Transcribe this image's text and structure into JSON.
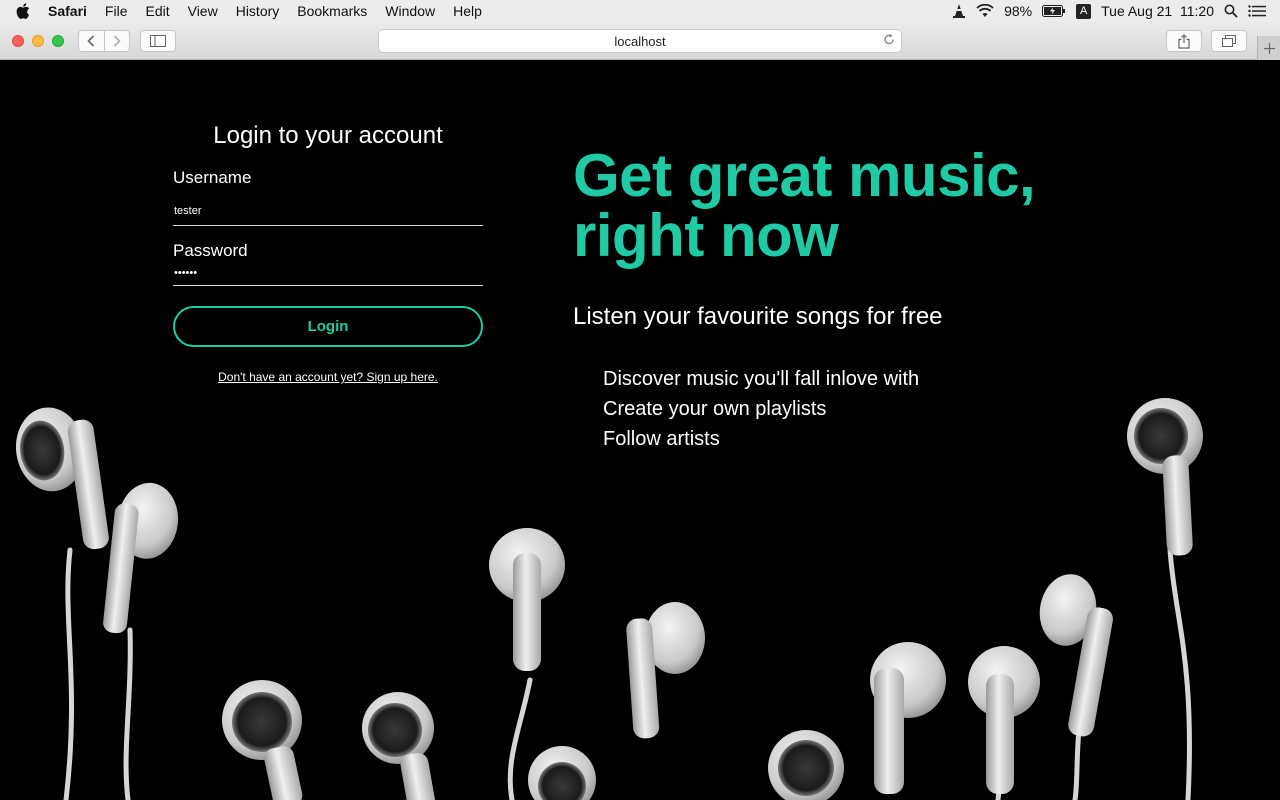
{
  "menubar": {
    "app_name": "Safari",
    "menus": [
      "File",
      "Edit",
      "View",
      "History",
      "Bookmarks",
      "Window",
      "Help"
    ],
    "battery": "98%",
    "input_source": "A",
    "datetime": "Tue Aug 21  11:20"
  },
  "browser": {
    "address": "localhost"
  },
  "login": {
    "title": "Login to your account",
    "username_label": "Username",
    "username_value": "tester",
    "password_label": "Password",
    "password_value": "tester",
    "button_label": "Login",
    "signup_link": "Don't have an account yet? Sign up here."
  },
  "hero": {
    "headline_line1": "Get great music,",
    "headline_line2": "right now",
    "subheading": "Listen your favourite songs for free",
    "features": [
      "Discover music you'll fall inlove with",
      "Create your own playlists",
      "Follow artists"
    ]
  },
  "colors": {
    "accent": "#1ecba4",
    "background": "#000000"
  }
}
